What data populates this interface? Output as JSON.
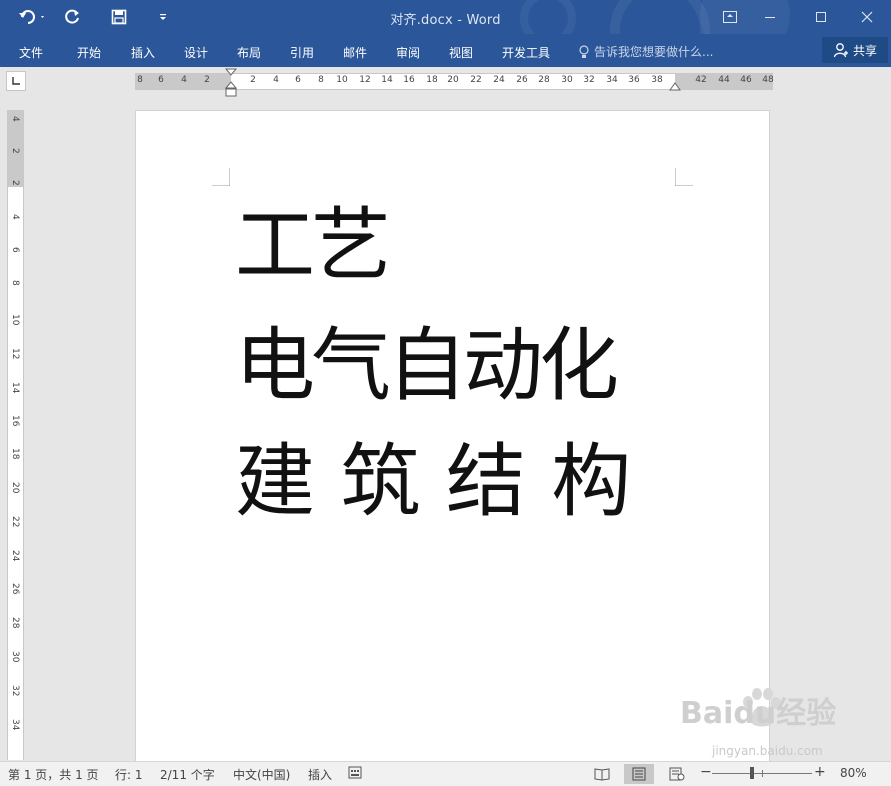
{
  "window": {
    "title": "对齐.docx - Word"
  },
  "ribbon": {
    "tabs": [
      "文件",
      "开始",
      "插入",
      "设计",
      "布局",
      "引用",
      "邮件",
      "审阅",
      "视图",
      "开发工具"
    ],
    "tell_me": "告诉我您想要做什么...",
    "share_label": "共享"
  },
  "ruler": {
    "horizontal_ticks": [
      "8",
      "6",
      "4",
      "2",
      "2",
      "4",
      "6",
      "8",
      "10",
      "12",
      "14",
      "16",
      "18",
      "20",
      "22",
      "24",
      "26",
      "28",
      "30",
      "32",
      "34",
      "36",
      "38",
      "42",
      "44",
      "46",
      "48"
    ],
    "vertical_ticks": [
      "4",
      "2",
      "2",
      "4",
      "6",
      "8",
      "10",
      "12",
      "14",
      "16",
      "18",
      "20",
      "22",
      "24",
      "26",
      "28",
      "30",
      "32",
      "34"
    ]
  },
  "document": {
    "lines": [
      "工艺",
      "电气自动化",
      "建 筑 结 构"
    ]
  },
  "statusbar": {
    "page": "第 1 页，共 1 页",
    "line": "行: 1",
    "word_count": "2/11 个字",
    "language": "中文(中国)",
    "mode": "插入",
    "zoom": "80%"
  },
  "watermark": {
    "brand": "Baidu经验",
    "url": "jingyan.baidu.com"
  },
  "colors": {
    "titlebar": "#2b579a",
    "page": "#ffffff",
    "canvas": "#e6e6e6"
  }
}
